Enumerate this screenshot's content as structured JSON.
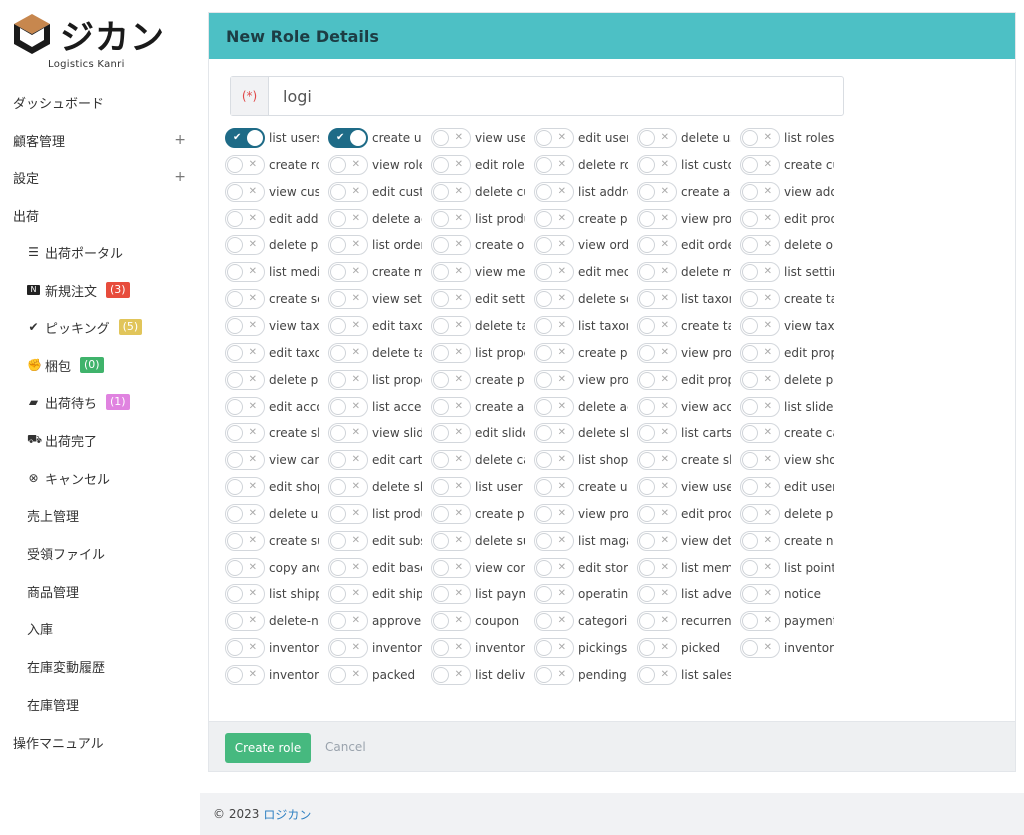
{
  "brand": {
    "logo_text": "ジカン",
    "logo_sub": "Logistics Kanri",
    "logo_icon": "box-icon"
  },
  "sidebar": {
    "dashboard": "ダッシュボード",
    "customers": "顧客管理",
    "settings": "設定",
    "shipping": "出荷",
    "shipping_portal": "出荷ポータル",
    "new_orders": "新規注文",
    "new_orders_count": "(3)",
    "picking": "ピッキング",
    "picking_count": "(5)",
    "packing": "梱包",
    "packing_count": "(0)",
    "awaiting": "出荷待ち",
    "awaiting_count": "(1)",
    "shipped": "出荷完了",
    "cancel": "キャンセル",
    "sales": "売上管理",
    "received_files": "受領ファイル",
    "products": "商品管理",
    "receiving": "入庫",
    "stock_history": "在庫変動履歴",
    "stock": "在庫管理",
    "manual": "操作マニュアル",
    "plus": "+",
    "badge_colors": {
      "new": "#e74c3c",
      "picking": "#e1c55a",
      "packing": "#3fb36b",
      "awaiting": "#e083e0"
    }
  },
  "card": {
    "title": "New Role Details",
    "required_marker": "(*)",
    "name_value": "logi"
  },
  "permissions": [
    {
      "label": "list users",
      "on": true
    },
    {
      "label": "create users",
      "on": true
    },
    {
      "label": "view users",
      "on": false
    },
    {
      "label": "edit users",
      "on": false
    },
    {
      "label": "delete users",
      "on": false
    },
    {
      "label": "list roles",
      "on": false
    },
    {
      "label": "create roles",
      "on": false
    },
    {
      "label": "view roles",
      "on": false
    },
    {
      "label": "edit roles",
      "on": false
    },
    {
      "label": "delete roles",
      "on": false
    },
    {
      "label": "list customers",
      "on": false
    },
    {
      "label": "create customers",
      "on": false
    },
    {
      "label": "view customers",
      "on": false
    },
    {
      "label": "edit customers",
      "on": false
    },
    {
      "label": "delete customers",
      "on": false
    },
    {
      "label": "list addresses",
      "on": false
    },
    {
      "label": "create addresses",
      "on": false
    },
    {
      "label": "view addresses",
      "on": false
    },
    {
      "label": "edit addresses",
      "on": false
    },
    {
      "label": "delete addresses",
      "on": false
    },
    {
      "label": "list products",
      "on": false
    },
    {
      "label": "create products",
      "on": false
    },
    {
      "label": "view products",
      "on": false
    },
    {
      "label": "edit products",
      "on": false
    },
    {
      "label": "delete products",
      "on": false
    },
    {
      "label": "list orders",
      "on": false
    },
    {
      "label": "create orders",
      "on": false
    },
    {
      "label": "view orders",
      "on": false
    },
    {
      "label": "edit orders",
      "on": false
    },
    {
      "label": "delete orders",
      "on": false
    },
    {
      "label": "list media",
      "on": false
    },
    {
      "label": "create media",
      "on": false
    },
    {
      "label": "view media",
      "on": false
    },
    {
      "label": "edit media",
      "on": false
    },
    {
      "label": "delete media",
      "on": false
    },
    {
      "label": "list settings",
      "on": false
    },
    {
      "label": "create settings",
      "on": false
    },
    {
      "label": "view settings",
      "on": false
    },
    {
      "label": "edit settings",
      "on": false
    },
    {
      "label": "delete settings",
      "on": false
    },
    {
      "label": "list taxonomies",
      "on": false
    },
    {
      "label": "create taxonomies",
      "on": false
    },
    {
      "label": "view taxonomies",
      "on": false
    },
    {
      "label": "edit taxonomies",
      "on": false
    },
    {
      "label": "delete taxonomies",
      "on": false
    },
    {
      "label": "list taxonomy terms",
      "on": false
    },
    {
      "label": "create taxonomy terms",
      "on": false
    },
    {
      "label": "view taxonomy terms",
      "on": false
    },
    {
      "label": "edit taxonomy terms",
      "on": false
    },
    {
      "label": "delete taxonomy terms",
      "on": false
    },
    {
      "label": "list properties",
      "on": false
    },
    {
      "label": "create properties",
      "on": false
    },
    {
      "label": "view properties",
      "on": false
    },
    {
      "label": "edit properties",
      "on": false
    },
    {
      "label": "delete properties",
      "on": false
    },
    {
      "label": "list property values",
      "on": false
    },
    {
      "label": "create property values",
      "on": false
    },
    {
      "label": "view property values",
      "on": false
    },
    {
      "label": "edit property values",
      "on": false
    },
    {
      "label": "delete property values",
      "on": false
    },
    {
      "label": "edit account",
      "on": false
    },
    {
      "label": "list accessories",
      "on": false
    },
    {
      "label": "create accessories",
      "on": false
    },
    {
      "label": "delete accessories",
      "on": false
    },
    {
      "label": "view accessories",
      "on": false
    },
    {
      "label": "list slides",
      "on": false
    },
    {
      "label": "create slides",
      "on": false
    },
    {
      "label": "view slides",
      "on": false
    },
    {
      "label": "edit slides",
      "on": false
    },
    {
      "label": "delete slides",
      "on": false
    },
    {
      "label": "list carts",
      "on": false
    },
    {
      "label": "create carts",
      "on": false
    },
    {
      "label": "view carts",
      "on": false
    },
    {
      "label": "edit carts",
      "on": false
    },
    {
      "label": "delete carts",
      "on": false
    },
    {
      "label": "list shops",
      "on": false
    },
    {
      "label": "create shops",
      "on": false
    },
    {
      "label": "view shops",
      "on": false
    },
    {
      "label": "edit shops",
      "on": false
    },
    {
      "label": "delete shops",
      "on": false
    },
    {
      "label": "list user groups",
      "on": false
    },
    {
      "label": "create user groups",
      "on": false
    },
    {
      "label": "view user groups",
      "on": false
    },
    {
      "label": "edit user groups",
      "on": false
    },
    {
      "label": "delete user groups",
      "on": false
    },
    {
      "label": "list product groups",
      "on": false
    },
    {
      "label": "create product groups",
      "on": false
    },
    {
      "label": "view product groups",
      "on": false
    },
    {
      "label": "edit product groups",
      "on": false
    },
    {
      "label": "delete product groups",
      "on": false
    },
    {
      "label": "create subscriptions",
      "on": false
    },
    {
      "label": "edit subscriptions",
      "on": false
    },
    {
      "label": "delete subscriptions",
      "on": false
    },
    {
      "label": "list magazines",
      "on": false
    },
    {
      "label": "view details",
      "on": false
    },
    {
      "label": "create notices",
      "on": false
    },
    {
      "label": "copy and paste",
      "on": false
    },
    {
      "label": "edit base",
      "on": false
    },
    {
      "label": "view contents",
      "on": false
    },
    {
      "label": "edit stores",
      "on": false
    },
    {
      "label": "list members",
      "on": false
    },
    {
      "label": "list points",
      "on": false
    },
    {
      "label": "list shipping",
      "on": false
    },
    {
      "label": "edit shipping",
      "on": false
    },
    {
      "label": "list payments",
      "on": false
    },
    {
      "label": "operating",
      "on": false
    },
    {
      "label": "list advertisements",
      "on": false
    },
    {
      "label": "notice",
      "on": false
    },
    {
      "label": "delete-notice",
      "on": false
    },
    {
      "label": "approve",
      "on": false
    },
    {
      "label": "coupon",
      "on": false
    },
    {
      "label": "categories",
      "on": false
    },
    {
      "label": "recurrence",
      "on": false
    },
    {
      "label": "payments",
      "on": false
    },
    {
      "label": "inventory",
      "on": false
    },
    {
      "label": "inventory",
      "on": false
    },
    {
      "label": "inventory",
      "on": false
    },
    {
      "label": "pickings",
      "on": false
    },
    {
      "label": "picked",
      "on": false
    },
    {
      "label": "inventory",
      "on": false
    },
    {
      "label": "inventory",
      "on": false
    },
    {
      "label": "packed",
      "on": false
    },
    {
      "label": "list delivery",
      "on": false
    },
    {
      "label": "pending",
      "on": false
    },
    {
      "label": "list sales",
      "on": false
    }
  ],
  "actions": {
    "create": "Create role",
    "cancel": "Cancel"
  },
  "footer": {
    "copyright": "© 2023",
    "company": "ロジカン"
  }
}
